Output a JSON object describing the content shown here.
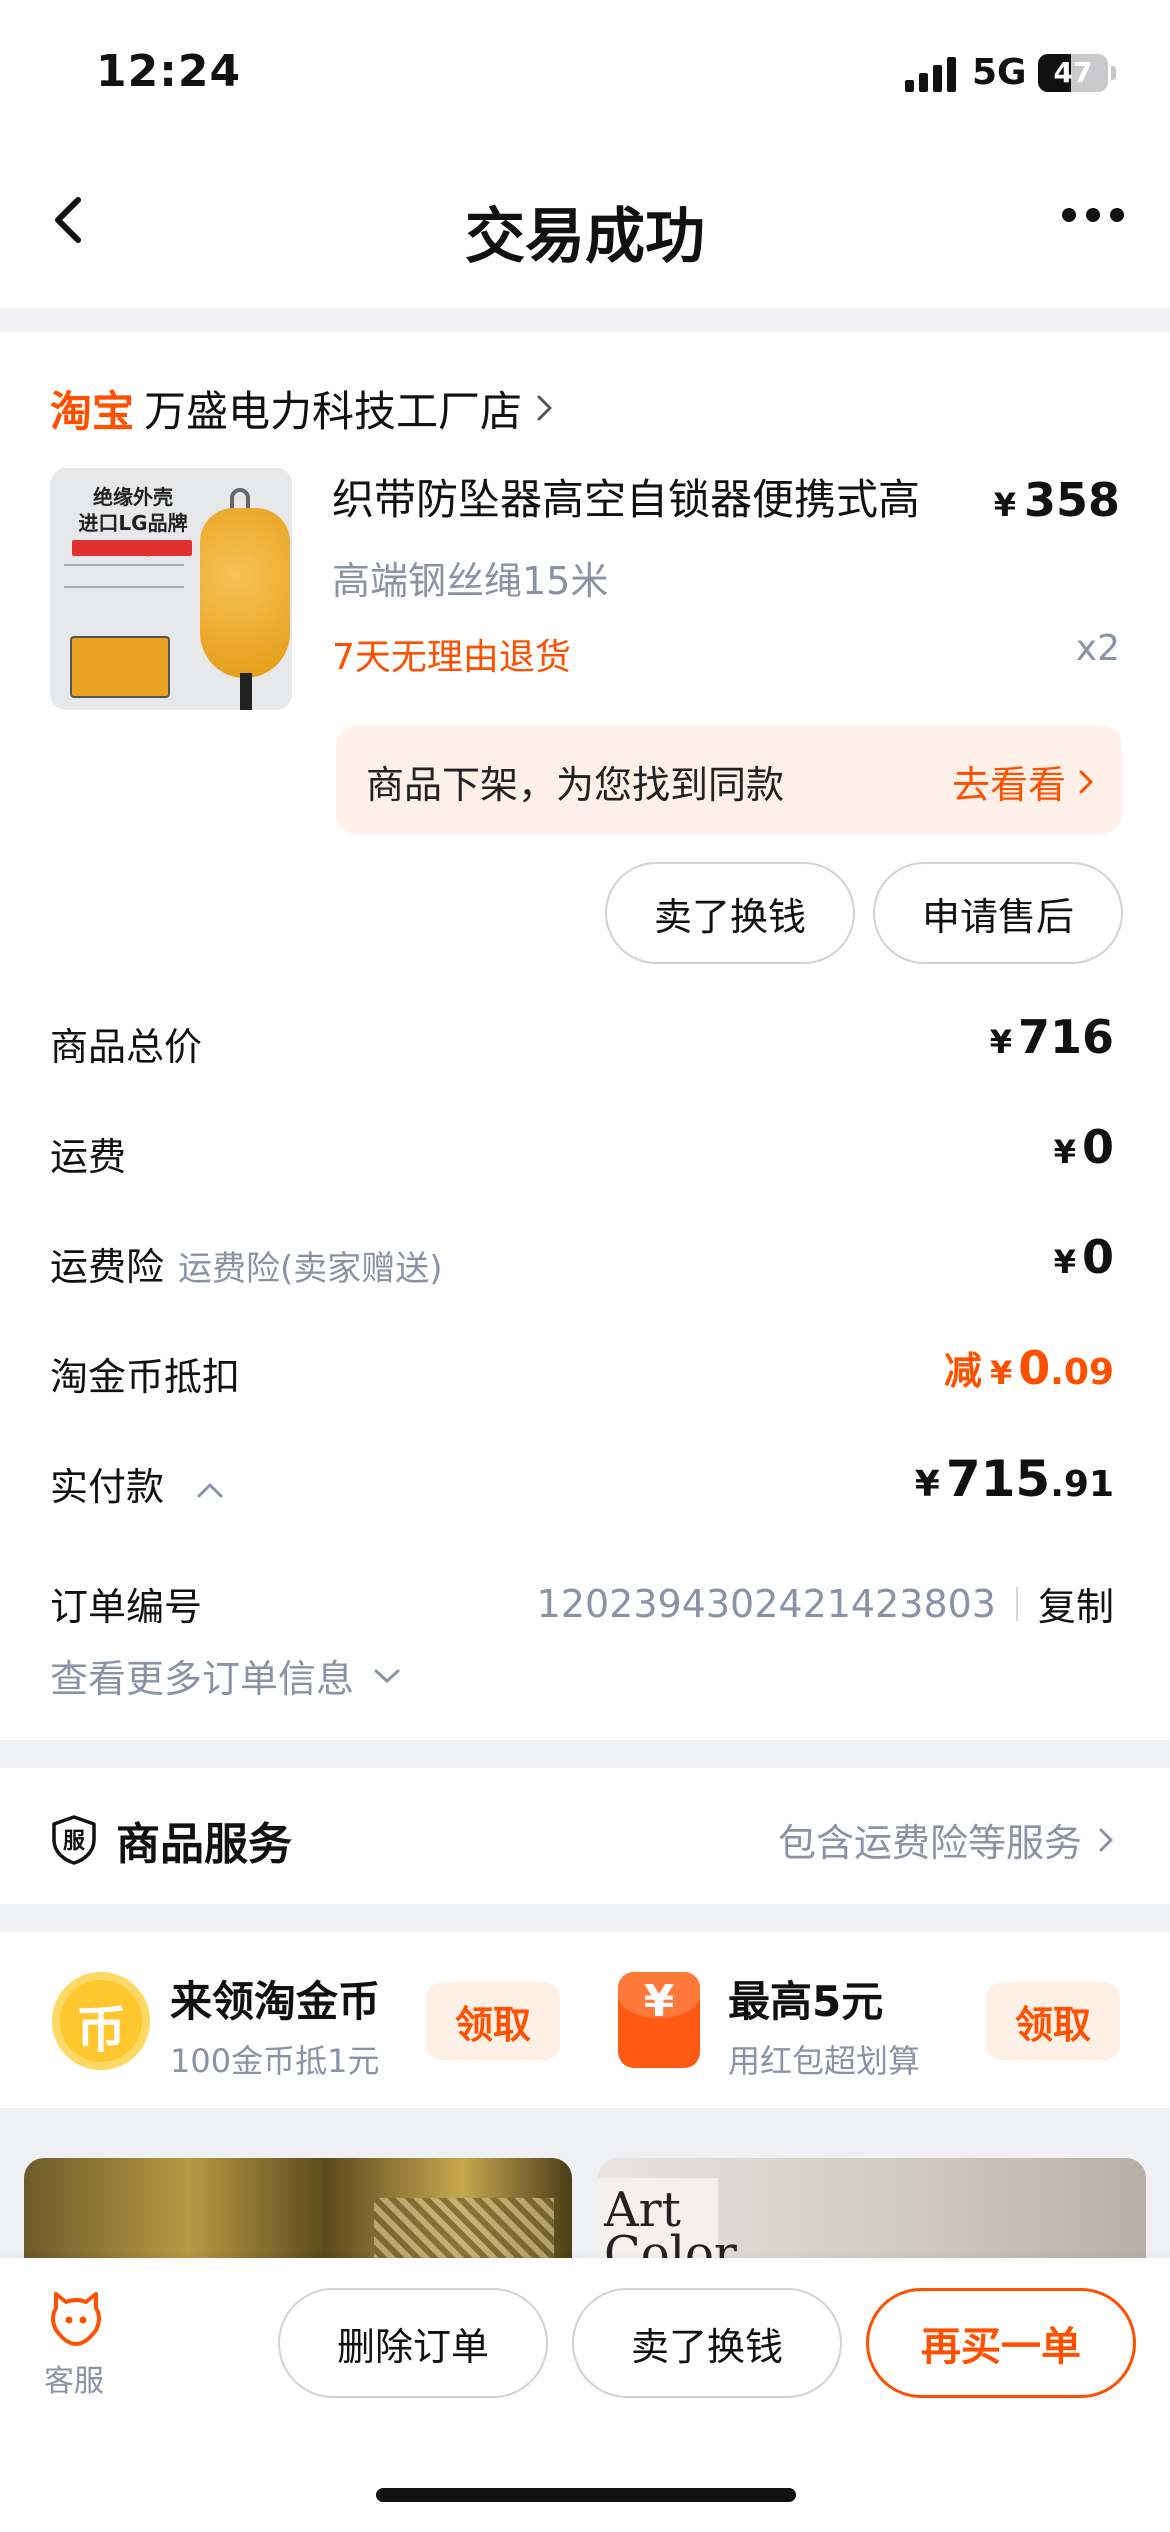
{
  "status_bar": {
    "time": "12:24",
    "network": "5G",
    "battery": "47",
    "battery_level": 0.47
  },
  "nav": {
    "title": "交易成功"
  },
  "shop": {
    "logo": "淘宝",
    "name": "万盛电力科技工厂店"
  },
  "product": {
    "image_text": "绝缘外壳\n进口LG品牌ABS",
    "title": "织带防坠器高空自锁器便携式高",
    "price_symbol": "¥",
    "price": "358",
    "sku": "高端钢丝绳15米",
    "return_policy": "7天无理由退货",
    "quantity": "x2"
  },
  "offshelf": {
    "text": "商品下架，为您找到同款",
    "link": "去看看"
  },
  "item_actions": {
    "sell": "卖了换钱",
    "aftersale": "申请售后"
  },
  "summary": {
    "total_label": "商品总价",
    "total_value": "716",
    "shipping_label": "运费",
    "shipping_value": "0",
    "insurance_label": "运费险",
    "insurance_sub": "运费险(卖家赠送)",
    "insurance_value": "0",
    "coin_label": "淘金币抵扣",
    "coin_prefix": "减",
    "coin_value_int": "0",
    "coin_value_dec": ".09",
    "paid_label": "实付款",
    "paid_value_int": "715",
    "paid_value_dec": ".91",
    "yen": "¥"
  },
  "order": {
    "number_label": "订单编号",
    "number": "1202394302421423803",
    "copy": "复制",
    "more_info": "查看更多订单信息"
  },
  "service": {
    "icon_text": "服",
    "title": "商品服务",
    "desc": "包含运费险等服务"
  },
  "promos": [
    {
      "icon_text": "币",
      "title": "来领淘金币",
      "sub": "100金币抵1元",
      "button": "领取"
    },
    {
      "icon_text": "¥",
      "title": "最高5元",
      "sub": "用红包超划算",
      "button": "领取"
    }
  ],
  "feed": {
    "right_text": "Art\nColor"
  },
  "bottom_bar": {
    "customer_service": "客服",
    "delete": "删除订单",
    "sell": "卖了换钱",
    "rebuy": "再买一单"
  },
  "colors": {
    "accent": "#ff5000",
    "muted": "#8a93a6"
  }
}
